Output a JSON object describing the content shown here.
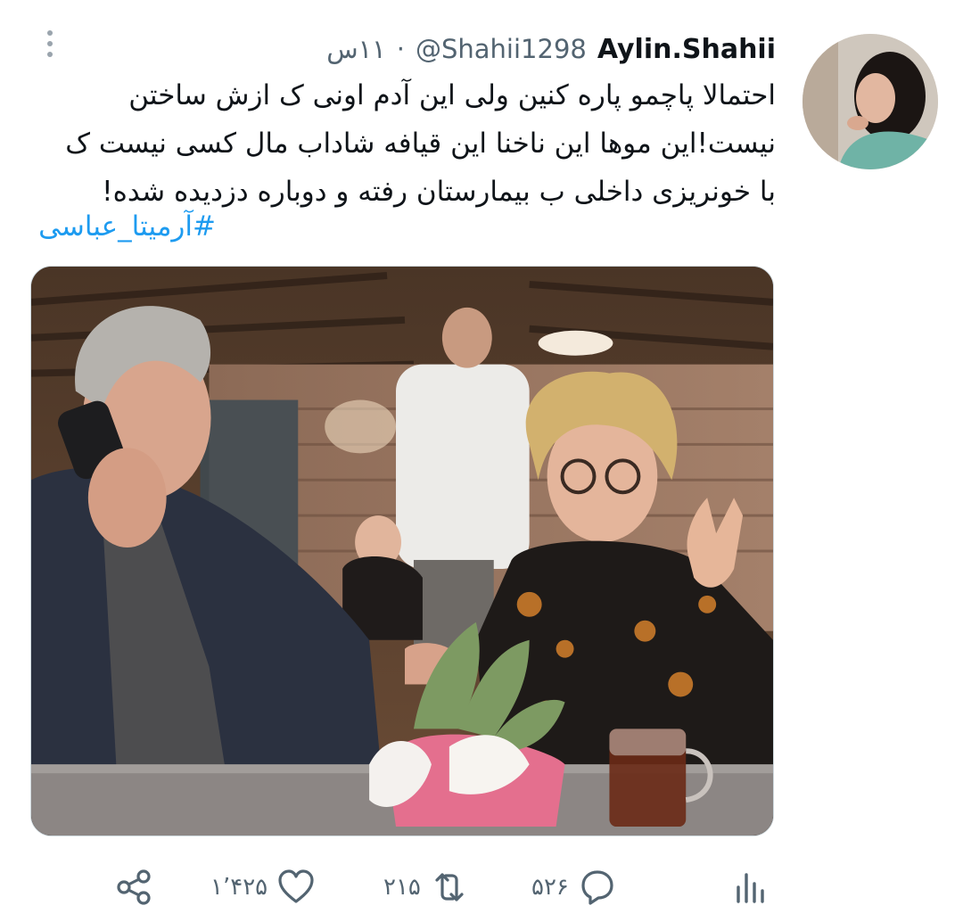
{
  "tweet": {
    "display_name": "Aylin.Shahii",
    "handle": "@Shahii1298",
    "separator": "·",
    "time": "۱۱س",
    "text_lines": [
      "احتمالا پاچمو پاره کنین ولی این آدم اونی ک ازش ساختن",
      "نیست!این موها این ناخنا این قیافه شاداب مال کسی نیست ک",
      "با خونریزی داخلی ب بیمارستان رفته و دوباره دزدیده شده!"
    ],
    "hashtag": "#آرمیتا_عباسی"
  },
  "actions": {
    "reply_count": "۵۲۶",
    "retweet_count": "۲۱۵",
    "like_count": "۱٬۴۲۵"
  },
  "icons": {
    "more": "more-vertical-icon",
    "share": "share-icon",
    "like": "heart-icon",
    "retweet": "retweet-icon",
    "reply": "reply-icon",
    "views": "views-icon"
  },
  "colors": {
    "accent": "#1d9bf0",
    "secondary_text": "#536471",
    "icon": "#536471"
  }
}
